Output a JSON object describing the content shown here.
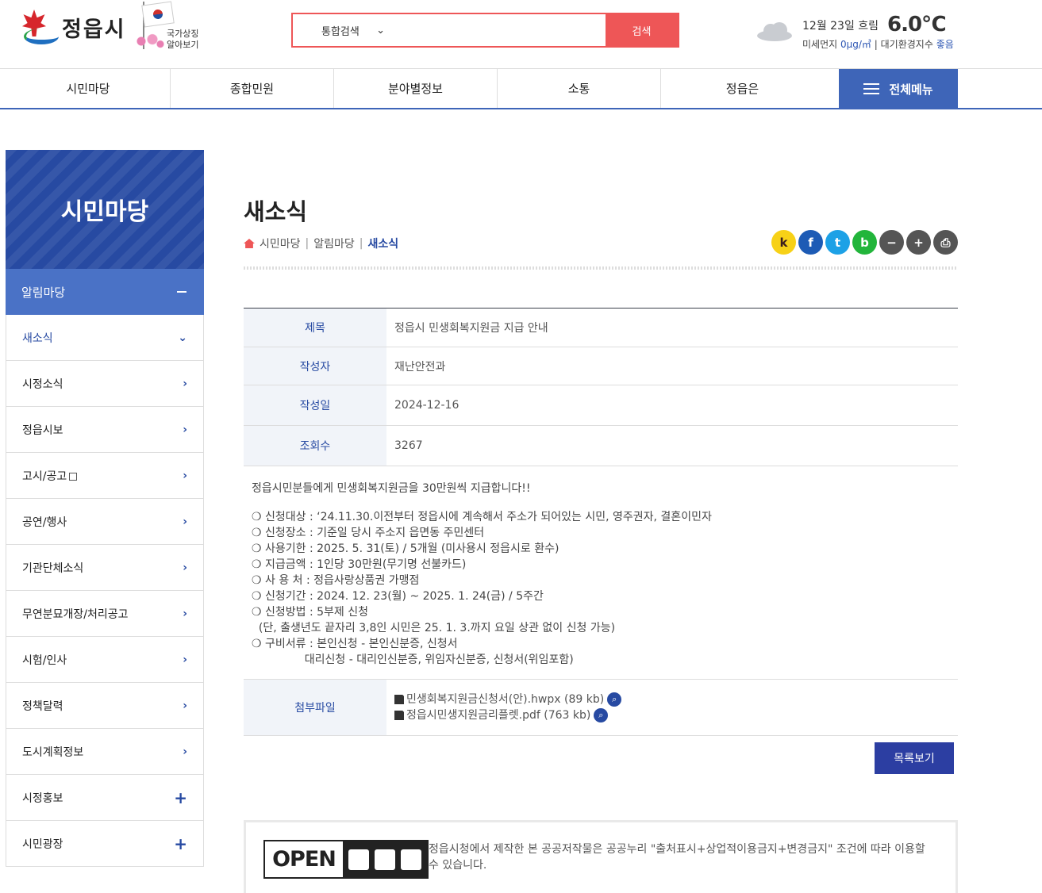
{
  "header": {
    "city_name": "정읍시",
    "national_symbol_line1": "국가상징",
    "national_symbol_line2": "알아보기",
    "search": {
      "category": "통합검색",
      "placeholder": "",
      "button": "검색"
    },
    "weather": {
      "icon": "cloud-icon",
      "date_text": "12월 23일 흐림",
      "temperature": "6.0℃",
      "dust_label": "미세먼지",
      "dust_value": "0μg/㎥",
      "air_label": "대기환경지수",
      "air_value": "좋음"
    }
  },
  "gnb": {
    "items": [
      "시민마당",
      "종합민원",
      "분야별정보",
      "소통",
      "정읍은"
    ],
    "all_menu": "전체메뉴"
  },
  "sidebar": {
    "title": "시민마당",
    "group": "알림마당",
    "items": [
      {
        "label": "새소식",
        "icon": "chevron-down-icon",
        "arrow": "⌄"
      },
      {
        "label": "시정소식",
        "icon": "chevron-right-icon",
        "arrow": "›"
      },
      {
        "label": "정읍시보",
        "icon": "chevron-right-icon",
        "arrow": "›"
      },
      {
        "label": "고시/공고",
        "icon": "chevron-right-icon",
        "arrow": "›"
      },
      {
        "label": "공연/행사",
        "icon": "chevron-right-icon",
        "arrow": "›"
      },
      {
        "label": "기관단체소식",
        "icon": "chevron-right-icon",
        "arrow": "›"
      },
      {
        "label": "무연분묘개장/처리공고",
        "icon": "chevron-right-icon",
        "arrow": "›"
      },
      {
        "label": "시험/인사",
        "icon": "chevron-right-icon",
        "arrow": "›"
      },
      {
        "label": "정책달력",
        "icon": "chevron-right-icon",
        "arrow": "›"
      },
      {
        "label": "도시계획정보",
        "icon": "chevron-right-icon",
        "arrow": "›"
      },
      {
        "label": "시정홍보",
        "icon": "plus-icon",
        "arrow": "+"
      },
      {
        "label": "시민광장",
        "icon": "plus-icon",
        "arrow": "+"
      }
    ]
  },
  "content": {
    "title": "새소식",
    "breadcrumb": [
      "시민마당",
      "알림마당",
      "새소식"
    ],
    "share_buttons": [
      {
        "icon": "kakaostory-icon",
        "glyph": "k",
        "color": "#f7d117",
        "text_color": "#3c1e1e"
      },
      {
        "icon": "facebook-icon",
        "glyph": "f",
        "color": "#1d5bb5",
        "text_color": "#ffffff"
      },
      {
        "icon": "twitter-icon",
        "glyph": "t",
        "color": "#1da1e6",
        "text_color": "#ffffff"
      },
      {
        "icon": "band-icon",
        "glyph": "b",
        "color": "#22b53b",
        "text_color": "#ffffff"
      },
      {
        "icon": "zoom-out-icon",
        "glyph": "−",
        "color": "#555555",
        "text_color": "#ffffff"
      },
      {
        "icon": "zoom-in-icon",
        "glyph": "+",
        "color": "#555555",
        "text_color": "#ffffff"
      },
      {
        "icon": "print-icon",
        "glyph": "⎙",
        "color": "#555555",
        "text_color": "#ffffff"
      }
    ],
    "fields": [
      {
        "label": "제목",
        "value": "정읍시 민생회복지원금 지급 안내"
      },
      {
        "label": "작성자",
        "value": "재난안전과"
      },
      {
        "label": "작성일",
        "value": "2024-12-16"
      },
      {
        "label": "조회수",
        "value": "3267"
      }
    ],
    "intro": "정읍시민분들에게 민생회복지원금을 30만원씩 지급합니다!!",
    "lines": [
      "❍ 신청대상 : ‘24.11.30.이전부터 정읍시에 계속해서 주소가 되어있는 시민, 영주권자, 결혼이민자",
      "❍ 신청장소 : 기준일 당시 주소지 읍면동 주민센터",
      "❍ 사용기한 : 2025. 5. 31(토) / 5개월 (미사용시 정읍시로 환수)",
      "❍ 지급금액 : 1인당 30만원(무기명 선불카드)",
      "❍ 사 용 처 : 정읍사랑상품권 가맹점",
      "❍ 신청기간 : 2024. 12. 23(월) ~ 2025. 1. 24(금) / 5주간",
      "❍ 신청방법 : 5부제 신청",
      "  (단, 출생년도 끝자리 3,8인 시민은 25. 1. 3.까지 요일 상관 없이 신청 가능)",
      "❍ 구비서류 : 본인신청 - 본인신분증, 신청서",
      "               대리신청 - 대리인신분증, 위임자신분증, 신청서(위임포함)"
    ],
    "attachment_label": "첨부파일",
    "attachments": [
      "민생회복지원금신청서(안).hwpx (89 kb)",
      "정읍시민생지원금리플렛.pdf (763 kb)"
    ],
    "list_button": "목록보기",
    "kogl_open": "OPEN",
    "kogl_text": "정읍시청에서 제작한 본 공공저작물은 공공누리 \"출처표시+상업적이용금지+변경금지\" 조건에 따라 이용할 수 있습니다."
  }
}
